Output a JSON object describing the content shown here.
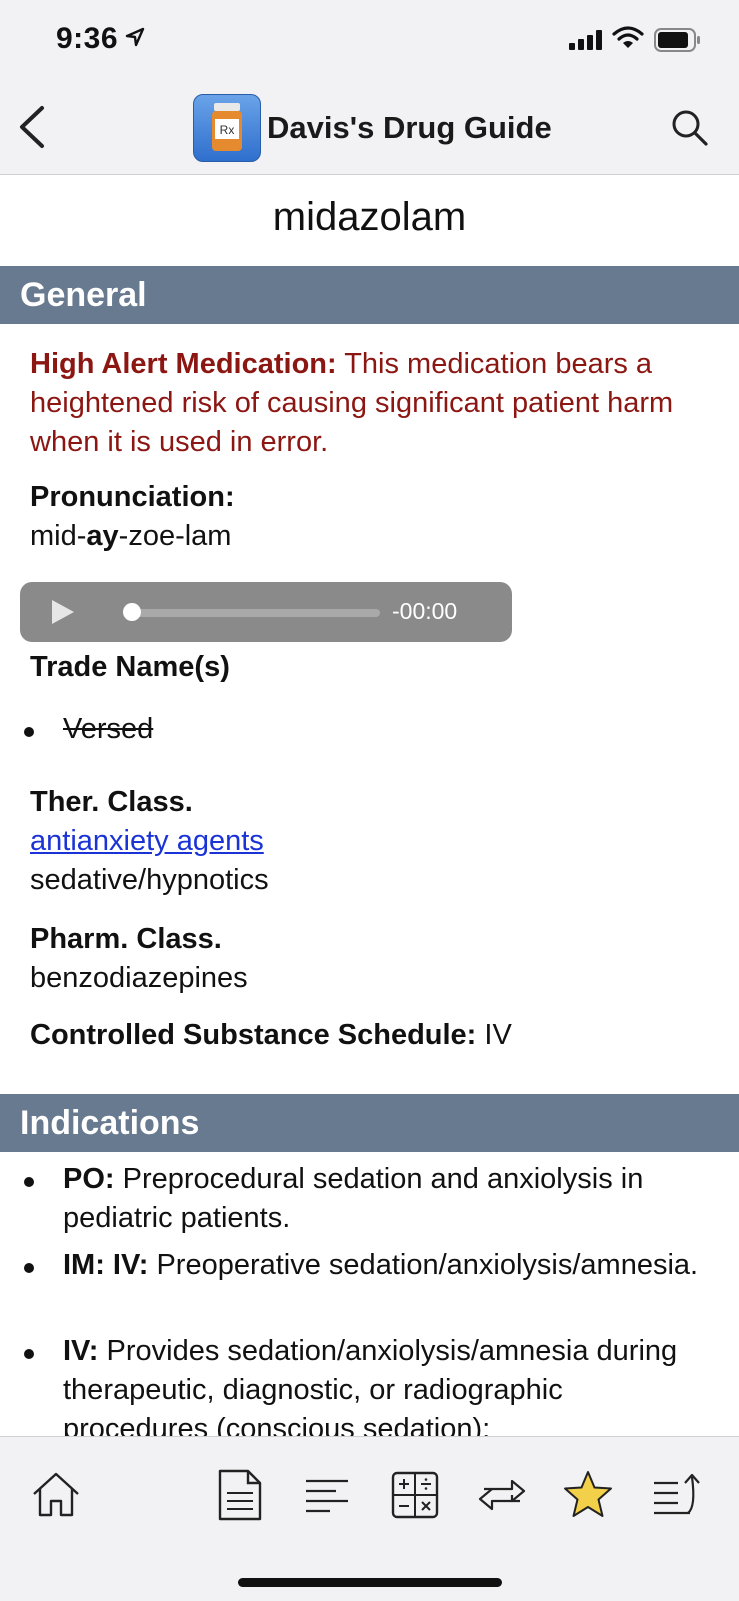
{
  "status_bar": {
    "time": "9:36"
  },
  "nav": {
    "title": "Davis's Drug Guide",
    "logo_text": "Rx"
  },
  "drug": {
    "name": "midazolam"
  },
  "general": {
    "header": "General",
    "alert_label": "High Alert Medication:",
    "alert_text": " This medication bears a heightened risk of causing significant patient harm when it is used in error.",
    "pronunciation_label": "Pronunciation:",
    "pronunciation_pre": "mid-",
    "pronunciation_bold": "ay",
    "pronunciation_post": "-zoe-lam",
    "audio_remaining": "-00:00",
    "trade_label": "Trade Name(s)",
    "trade_names": [
      "Versed"
    ],
    "ther_class_label": "Ther. Class.",
    "ther_class_link": "antianxiety agents",
    "ther_class_other": "sedative/hypnotics",
    "pharm_class_label": "Pharm. Class.",
    "pharm_class_value": "benzodiazepines",
    "schedule_label": "Controlled Substance Schedule:",
    "schedule_value": " IV"
  },
  "indications": {
    "header": "Indications",
    "items": [
      {
        "route": "PO:",
        "text": " Preprocedural sedation and anxiolysis in pediatric patients."
      },
      {
        "route": "IM: IV:",
        "text": " Preoperative sedation/anxiolysis/amnesia."
      },
      {
        "route": "IV:",
        "text": " Provides sedation/anxiolysis/amnesia during therapeutic, diagnostic, or radiographic procedures (conscious sedation);"
      }
    ]
  },
  "toolbar": {
    "icons": [
      "home-icon",
      "document-icon",
      "outline-icon",
      "calculator-icon",
      "interactions-icon",
      "favorite-star-icon",
      "share-icon"
    ],
    "star_color": "#f3d04a"
  }
}
